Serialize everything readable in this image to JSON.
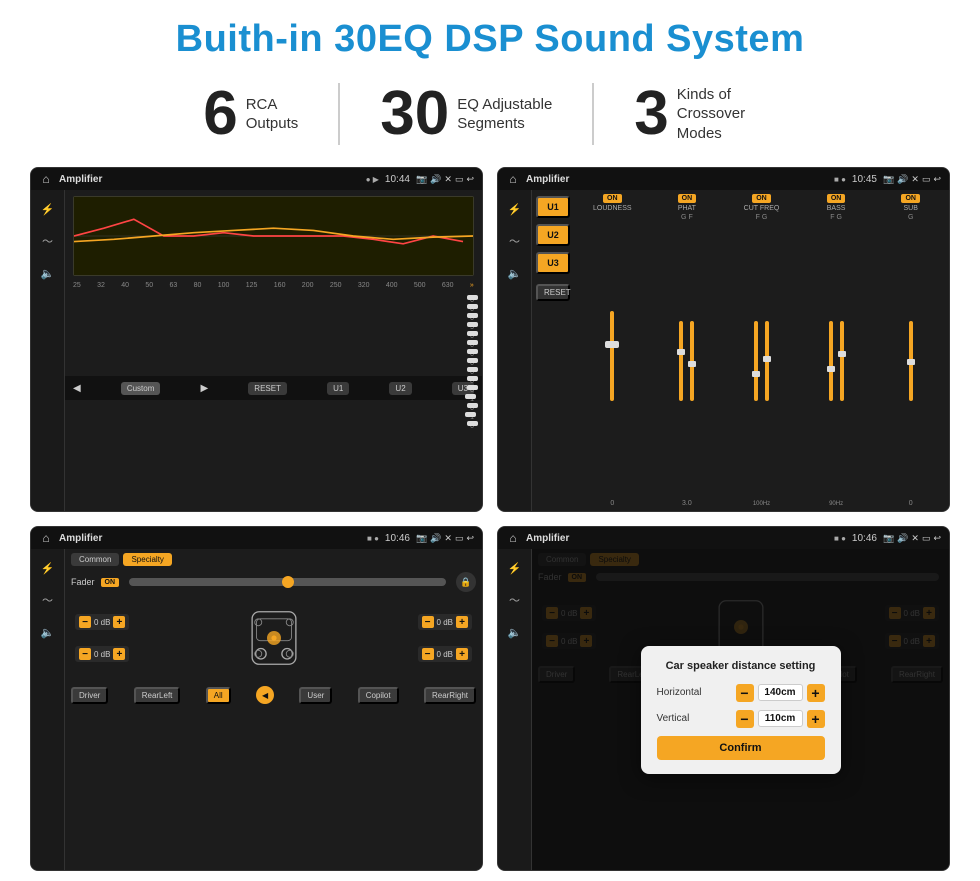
{
  "page": {
    "title": "Buith-in 30EQ DSP Sound System",
    "stats": [
      {
        "number": "6",
        "label": "RCA\nOutputs"
      },
      {
        "number": "30",
        "label": "EQ Adjustable\nSegments"
      },
      {
        "number": "3",
        "label": "Kinds of\nCrossover Modes"
      }
    ]
  },
  "screen1": {
    "statusbar": {
      "title": "Amplifier",
      "time": "10:44"
    },
    "eq_labels": [
      "25",
      "32",
      "40",
      "50",
      "63",
      "80",
      "100",
      "125",
      "160",
      "200",
      "250",
      "320",
      "400",
      "500",
      "630"
    ],
    "eq_values": [
      "0",
      "0",
      "0",
      "5",
      "0",
      "0",
      "0",
      "0",
      "0",
      "0",
      "0",
      "-1",
      "0",
      "-1"
    ],
    "bottom_buttons": [
      "Custom",
      "RESET",
      "U1",
      "U2",
      "U3"
    ]
  },
  "screen2": {
    "statusbar": {
      "title": "Amplifier",
      "time": "10:45"
    },
    "left_buttons": [
      "U1",
      "U2",
      "U3"
    ],
    "columns": [
      {
        "label": "LOUDNESS",
        "on": true
      },
      {
        "label": "PHAT",
        "on": true
      },
      {
        "label": "CUT FREQ",
        "on": true
      },
      {
        "label": "BASS",
        "on": true
      },
      {
        "label": "SUB",
        "on": true
      }
    ],
    "reset_label": "RESET"
  },
  "screen3": {
    "statusbar": {
      "title": "Amplifier",
      "time": "10:46"
    },
    "tabs": [
      "Common",
      "Specialty"
    ],
    "fader_label": "Fader",
    "on_label": "ON",
    "vol_left_top": "0 dB",
    "vol_left_bottom": "0 dB",
    "vol_right_top": "0 dB",
    "vol_right_bottom": "0 dB",
    "bottom_btns": [
      "Driver",
      "RearLeft",
      "All",
      "User",
      "Copilot",
      "RearRight"
    ]
  },
  "screen4": {
    "statusbar": {
      "title": "Amplifier",
      "time": "10:46"
    },
    "tabs": [
      "Common",
      "Specialty"
    ],
    "dialog": {
      "title": "Car speaker distance setting",
      "horizontal_label": "Horizontal",
      "horizontal_value": "140cm",
      "vertical_label": "Vertical",
      "vertical_value": "110cm",
      "confirm_label": "Confirm"
    },
    "vol_right_top": "0 dB",
    "vol_right_bottom": "0 dB",
    "bottom_btns": [
      "Driver",
      "RearLeft",
      "All",
      "User",
      "Copilot",
      "RearRight"
    ]
  }
}
